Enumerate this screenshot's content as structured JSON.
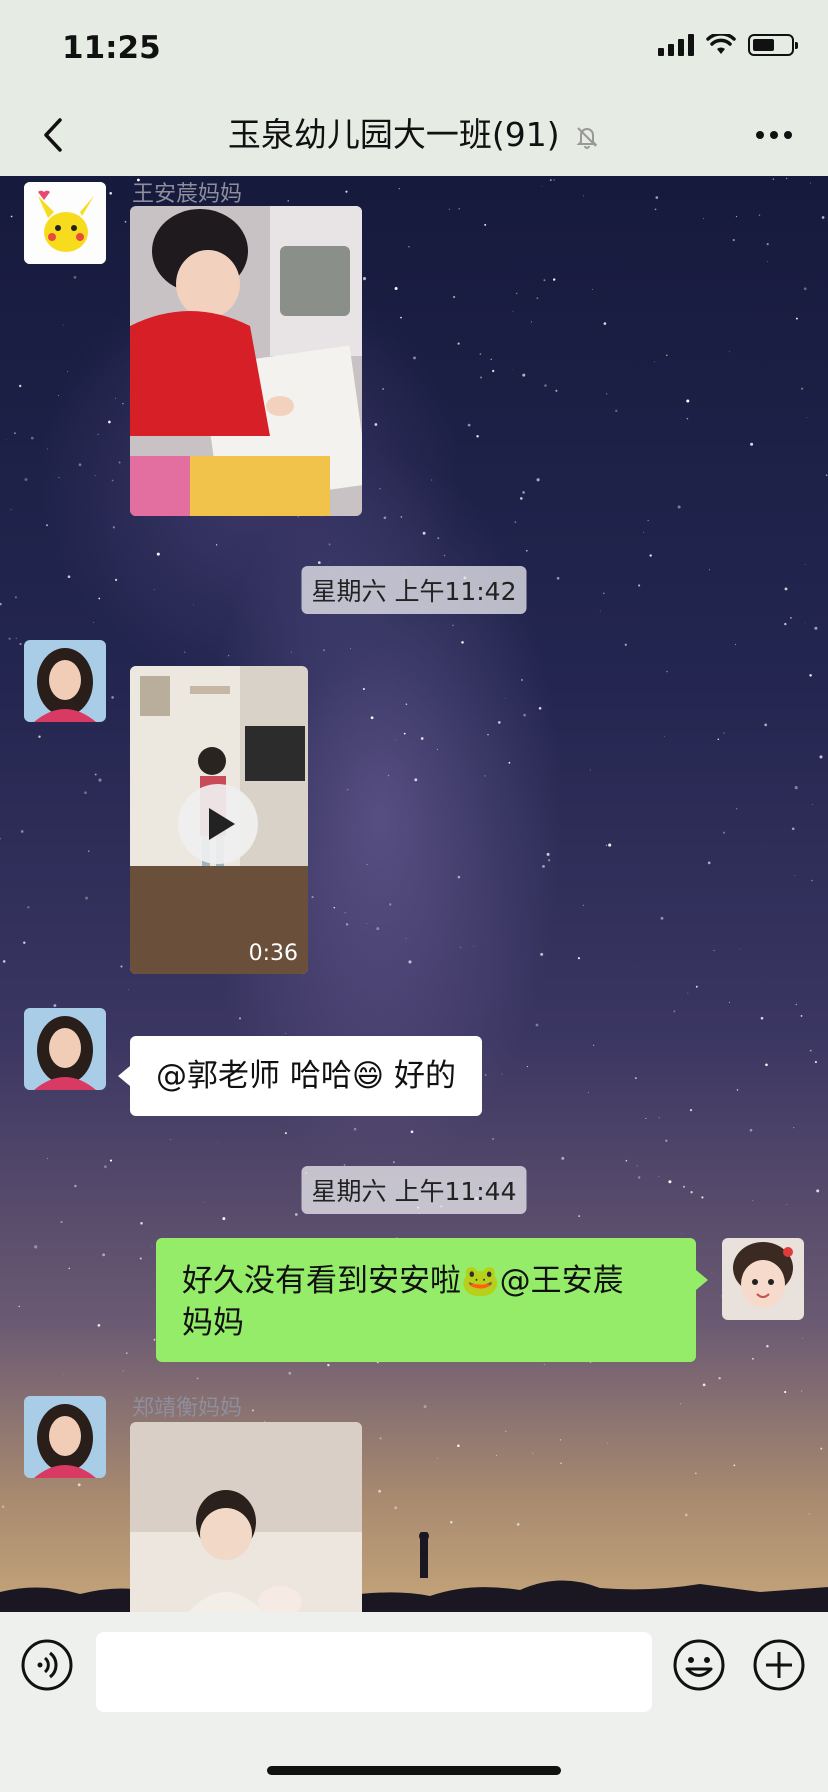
{
  "status": {
    "time": "11:25",
    "signal_icon": "signal-icon",
    "wifi_icon": "wifi-icon",
    "battery_icon": "battery-icon",
    "battery_level": 0.5
  },
  "nav": {
    "title": "玉泉幼儿园大一班(91)",
    "mute_icon": "bell-slash-icon",
    "back_icon": "chevron-left-icon",
    "more_icon": "ellipsis-icon"
  },
  "messages": [
    {
      "kind": "image",
      "sender": "王安莀妈妈",
      "side": "left",
      "content": "child-drawing-photo"
    },
    {
      "kind": "timestamp",
      "text": "星期六 上午11:42"
    },
    {
      "kind": "video",
      "sender": "",
      "side": "left",
      "duration": "0:36"
    },
    {
      "kind": "text",
      "sender": "",
      "side": "left",
      "text": "@郭老师 哈哈😄 好的"
    },
    {
      "kind": "timestamp",
      "text": "星期六 上午11:44"
    },
    {
      "kind": "text",
      "sender": "",
      "side": "right",
      "line1": "好久没有看到安安啦🐸@王安莀",
      "line2": "妈妈"
    },
    {
      "kind": "image",
      "sender": "郑靖衡妈妈",
      "side": "left",
      "content": "boy-with-baby-photo"
    }
  ],
  "input": {
    "voice_icon": "voice-icon",
    "emoji_icon": "emoji-icon",
    "plus_icon": "plus-circle-icon",
    "text": ""
  },
  "colors": {
    "nav_bg": "#e6ebe4",
    "bubble_green": "#95ec69",
    "bubble_white": "#ffffff",
    "sender_gray": "#8e8e9c"
  }
}
